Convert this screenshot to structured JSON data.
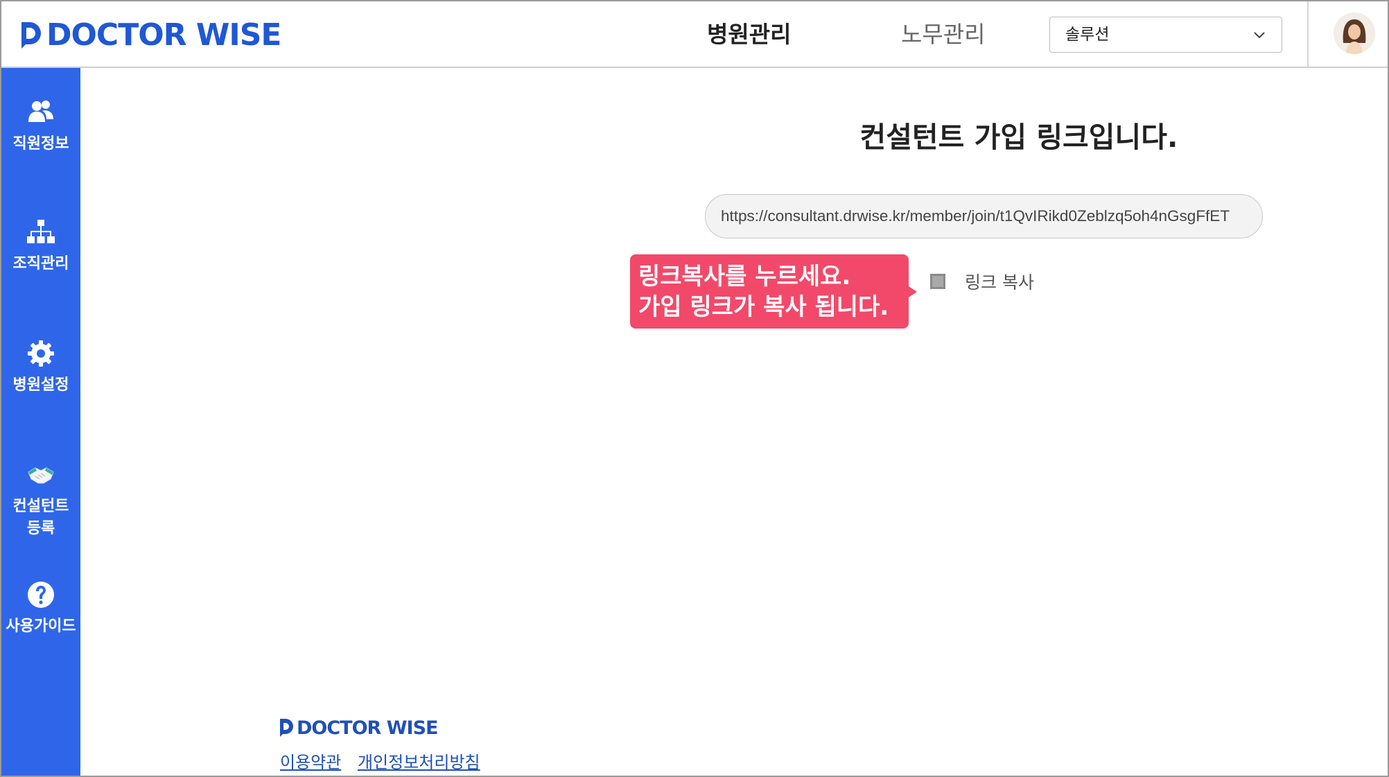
{
  "header": {
    "logo_text": "DOCTOR WISE",
    "nav": [
      {
        "label": "병원관리",
        "active": true
      },
      {
        "label": "노무관리",
        "active": false
      }
    ],
    "select": {
      "value": "솔루션"
    },
    "avatar_icon": "user-avatar-icon"
  },
  "sidebar": {
    "color": "#2f66e9",
    "items": [
      {
        "label": "직원정보",
        "icon": "people-icon"
      },
      {
        "label": "조직관리",
        "icon": "org-chart-icon"
      },
      {
        "label": "병원설정",
        "icon": "gear-icon"
      },
      {
        "label": "컨설턴트\n등록",
        "icon": "handshake-icon"
      },
      {
        "label": "사용가이드",
        "icon": "question-icon"
      }
    ]
  },
  "main": {
    "title": "컨설턴트 가입 링크입니다.",
    "link_url": "https://consultant.drwise.kr/member/join/t1QvIRikd0Zeblzq5oh4nGsgFfET",
    "copy_label": "링크 복사",
    "copy_icon": "copy-icon"
  },
  "callout": {
    "color": "#f2496a",
    "lines": [
      "링크복사를 누르세요.",
      "가입 링크가 복사 됩니다."
    ]
  },
  "footer": {
    "logo_text": "DOCTOR WISE",
    "links": [
      "이용약관",
      "개인정보처리방침"
    ]
  }
}
